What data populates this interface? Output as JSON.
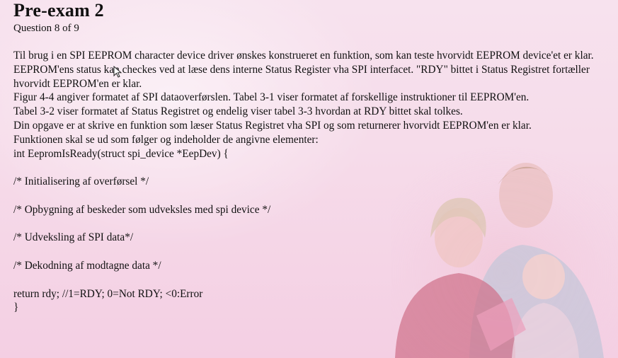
{
  "exam": {
    "title": "Pre-exam 2",
    "progress": "Question 8 of 9"
  },
  "question": {
    "paragraphs": [
      "Til brug i en SPI EEPROM character device driver ønskes konstrueret en funktion, som kan teste hvorvidt EEPROM device'et er klar.",
      "EEPROM'ens status kan checkes ved at læse dens interne Status Register vha SPI interfacet. \"RDY\" bittet i Status Registret fortæller hvorvidt EEPROM'en er klar.",
      "Figur 4-4 angiver formatet af SPI dataoverførslen. Tabel 3-1 viser formatet af forskellige instruktioner til EEPROM'en.",
      "Tabel 3-2 viser formatet af Status Registret og endelig viser tabel 3-3 hvordan at RDY bittet skal tolkes.",
      "Din opgave er at skrive en funktion som læser Status Registret vha SPI og som returnerer hvorvidt EEPROM'en er klar.",
      "Funktionen skal se ud som følger og indeholder de angivne elementer:"
    ],
    "code": {
      "signature": "int EepromIsReady(struct spi_device *EepDev) {",
      "comment_init": "/* Initialisering af overførsel */",
      "comment_build": "/* Opbygning af beskeder som udveksles med spi device */",
      "comment_exchange": "/* Udveksling af SPI data*/",
      "comment_decode": "/* Dekodning af modtagne data */",
      "return_line": "return rdy; //1=RDY; 0=Not RDY; <0:Error",
      "closing": "}"
    }
  },
  "icons": {
    "cursor": "mouse-pointer-icon",
    "photo": "family-photo"
  }
}
